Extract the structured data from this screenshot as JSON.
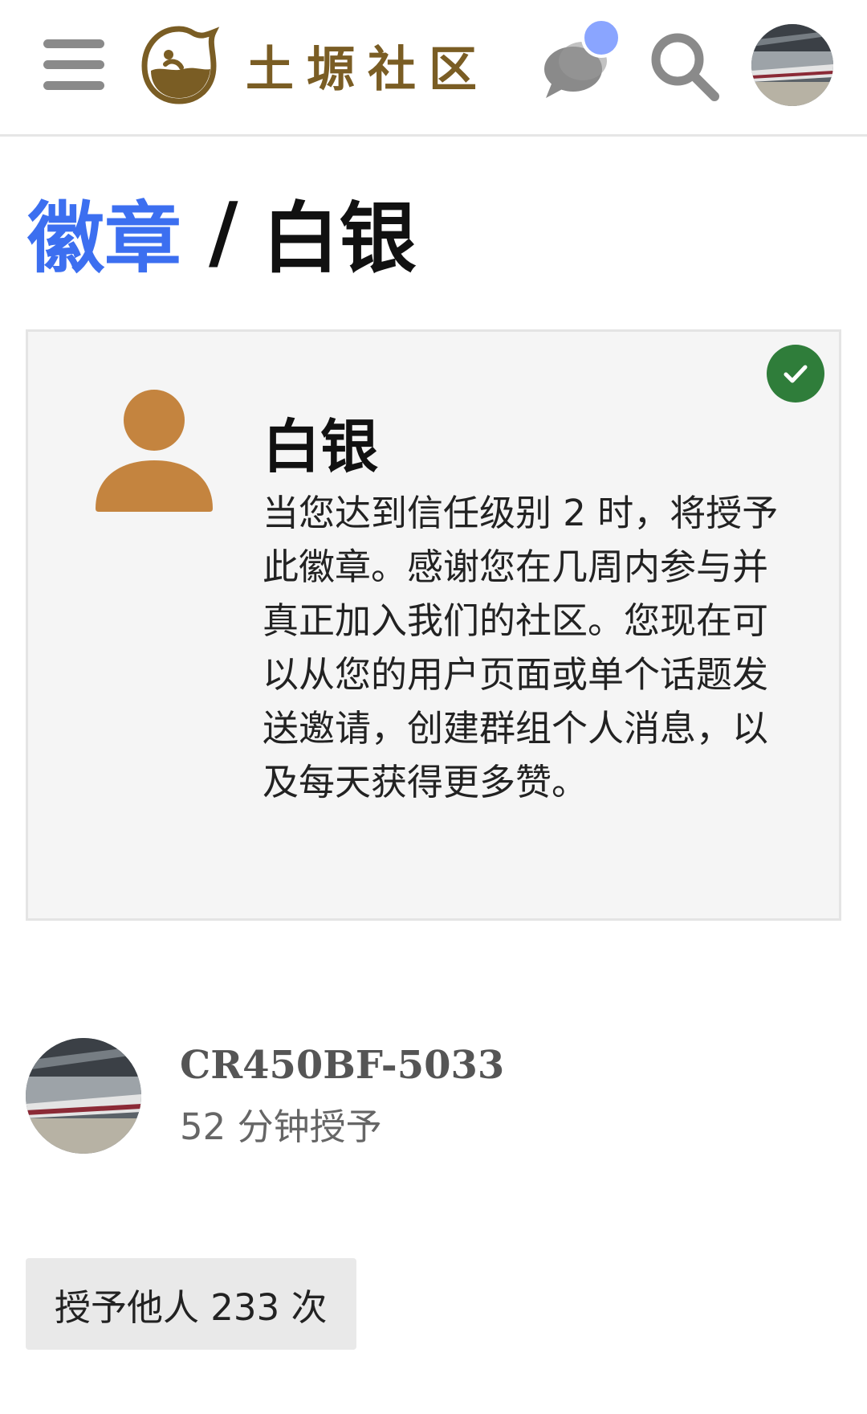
{
  "header": {
    "menu_icon": "hamburger-menu-icon",
    "site_name": "土塬社区",
    "logo_icon": "teapot-cat-logo",
    "chat_icon": "chat-bubbles-icon",
    "chat_dot_color": "#8aa5ff",
    "search_icon": "search-icon",
    "avatar": "user-avatar-train-photo"
  },
  "breadcrumb": {
    "parent": "徽章",
    "separator": "/",
    "current": "白银"
  },
  "badge": {
    "name": "白银",
    "icon": "user-silhouette-icon",
    "icon_color": "#c4843f",
    "granted_check_color": "#2f7d3a",
    "description": "当您达到信任级别 2 时，将授予此徽章。感谢您在几周内参与并真正加入我们的社区。您现在可以从您的用户页面或单个话题发送邀请，创建群组个人消息，以及每天获得更多赞。"
  },
  "recipient": {
    "username": "CR450BF-5033",
    "granted_time": "52 分钟授予"
  },
  "granted_count_label": "授予他人 233 次",
  "colors": {
    "accent": "#3c6ff0",
    "brand": "#7a5d24"
  }
}
